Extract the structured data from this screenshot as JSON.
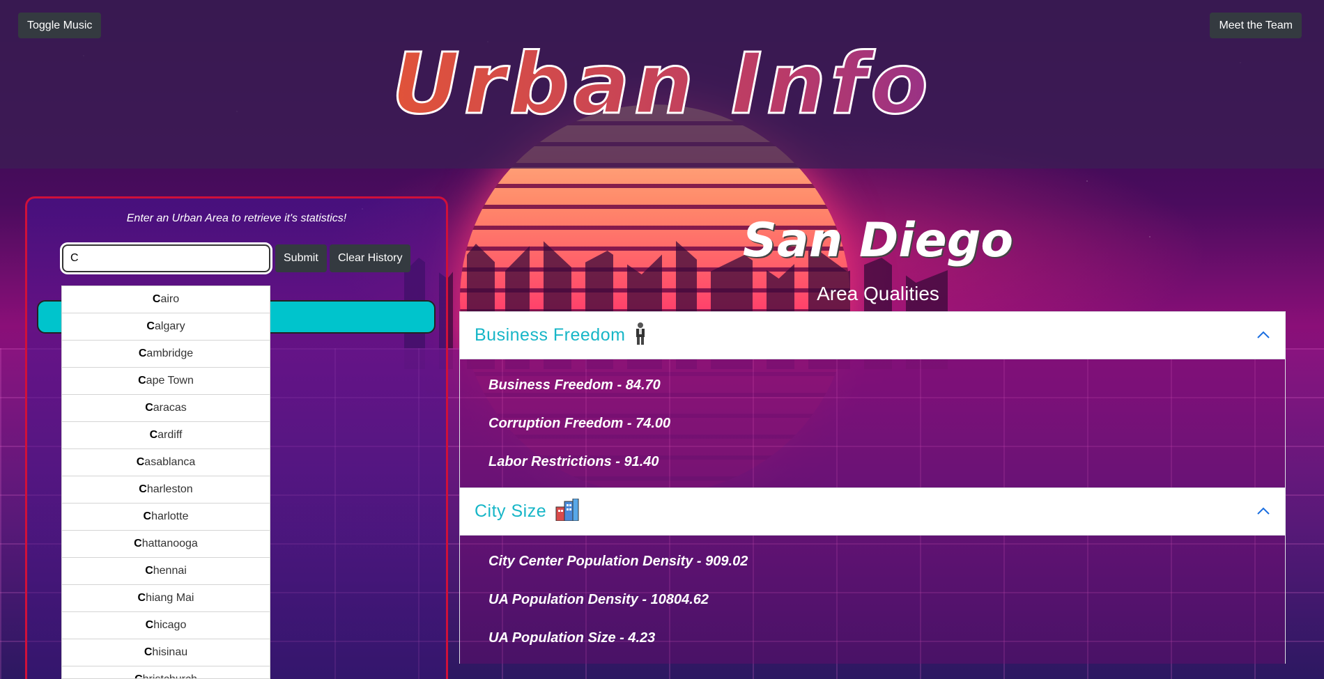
{
  "header": {
    "title": "Urban Info",
    "toggle_music": "Toggle Music",
    "meet_team": "Meet the Team"
  },
  "search": {
    "prompt": "Enter an Urban Area to retrieve it's statistics!",
    "value": "C",
    "submit_label": "Submit",
    "clear_label": "Clear History",
    "suggestions": [
      {
        "match": "C",
        "rest": "airo"
      },
      {
        "match": "C",
        "rest": "algary"
      },
      {
        "match": "C",
        "rest": "ambridge"
      },
      {
        "match": "C",
        "rest": "ape Town"
      },
      {
        "match": "C",
        "rest": "aracas"
      },
      {
        "match": "C",
        "rest": "ardiff"
      },
      {
        "match": "C",
        "rest": "asablanca"
      },
      {
        "match": "C",
        "rest": "harleston"
      },
      {
        "match": "C",
        "rest": "harlotte"
      },
      {
        "match": "C",
        "rest": "hattanooga"
      },
      {
        "match": "C",
        "rest": "hennai"
      },
      {
        "match": "C",
        "rest": "hiang Mai"
      },
      {
        "match": "C",
        "rest": "hicago"
      },
      {
        "match": "C",
        "rest": "hisinau"
      },
      {
        "match": "C",
        "rest": "hristchurch"
      }
    ]
  },
  "results": {
    "city": "San Diego",
    "section_heading": "Area Qualities",
    "categories": [
      {
        "title": "Business Freedom",
        "icon": "businessman-icon",
        "stats": [
          "Business Freedom - 84.70",
          "Corruption Freedom - 74.00",
          "Labor Restrictions - 91.40"
        ]
      },
      {
        "title": "City Size",
        "icon": "city-buildings-icon",
        "stats": [
          "City Center Population Density - 909.02",
          "UA Population Density - 10804.62",
          "UA Population Size - 4.23"
        ]
      }
    ]
  },
  "colors": {
    "accent_cyan": "#00c4cc",
    "accordion_title": "#17b6c7",
    "panel_border": "#d0103a",
    "dark_button": "#343a40"
  }
}
